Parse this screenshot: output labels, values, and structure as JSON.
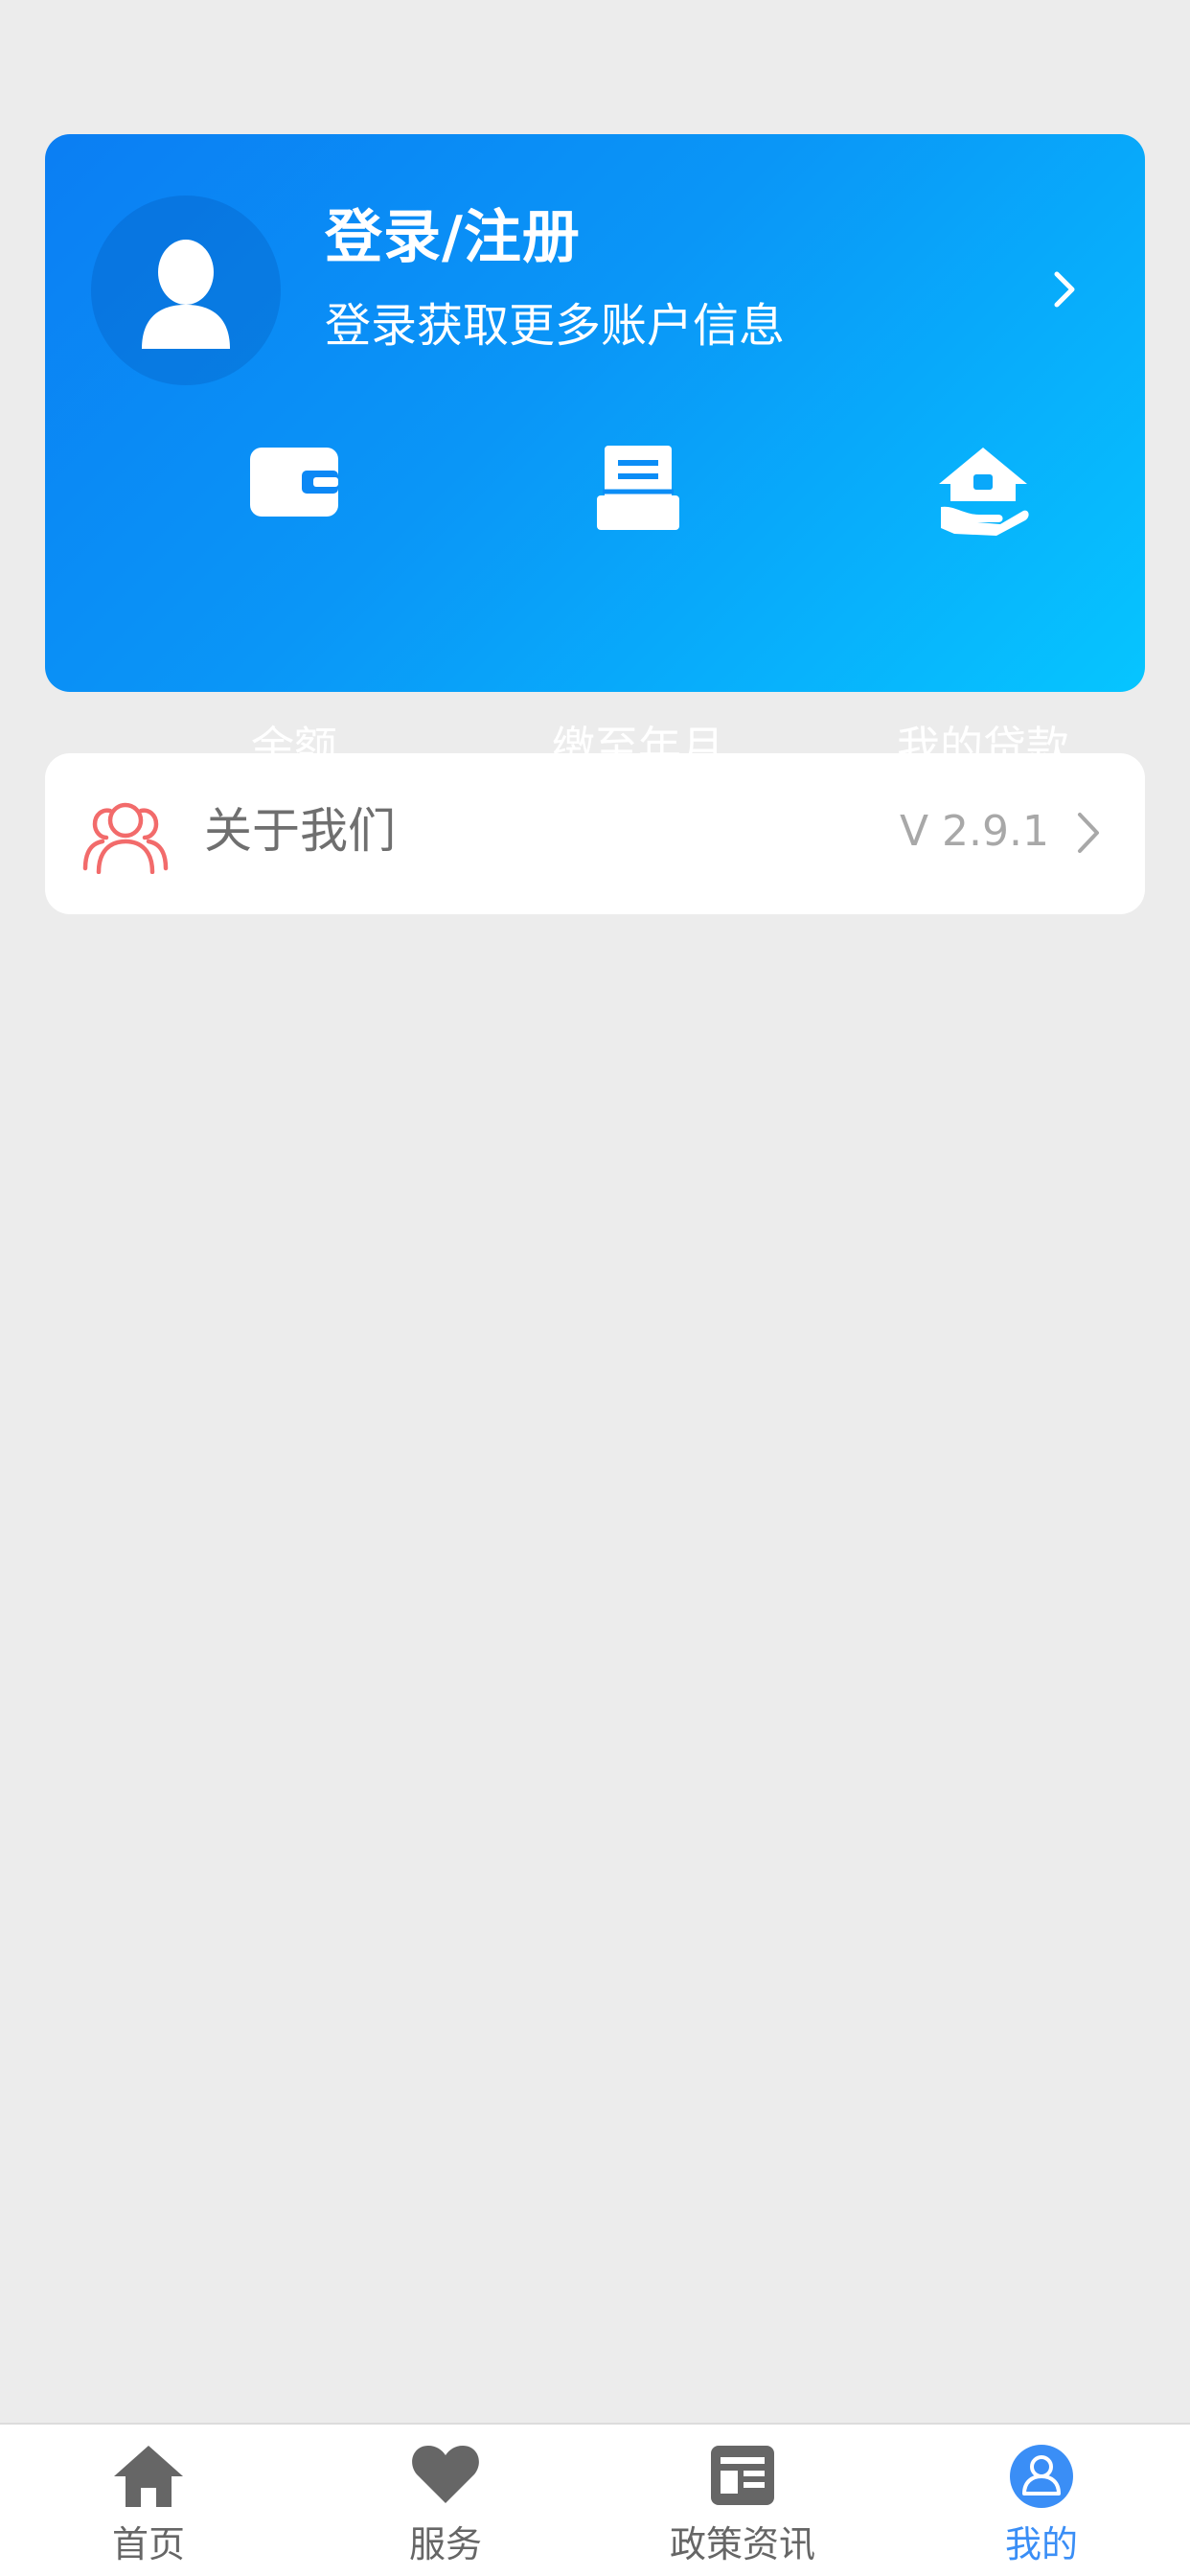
{
  "header": {
    "login_title": "登录/注册",
    "login_subtitle": "登录获取更多账户信息"
  },
  "quick_actions": [
    {
      "label": "余额",
      "icon": "wallet-icon"
    },
    {
      "label": "缴至年月",
      "icon": "bill-icon"
    },
    {
      "label": "我的贷款",
      "icon": "house-loan-icon"
    }
  ],
  "about": {
    "label": "关于我们",
    "version": "V 2.9.1",
    "icon": "people-icon"
  },
  "tabbar": {
    "items": [
      {
        "label": "首页",
        "icon": "home-icon"
      },
      {
        "label": "服务",
        "icon": "heart-icon"
      },
      {
        "label": "政策资讯",
        "icon": "news-icon"
      },
      {
        "label": "我的",
        "icon": "user-icon"
      }
    ],
    "active_index": 3
  },
  "colors": {
    "card_gradient_start": "#0b7ef3",
    "card_gradient_end": "#06c5ff",
    "active_tab": "#3a8ef6",
    "about_icon": "#f26b6b",
    "background": "#ececec"
  }
}
